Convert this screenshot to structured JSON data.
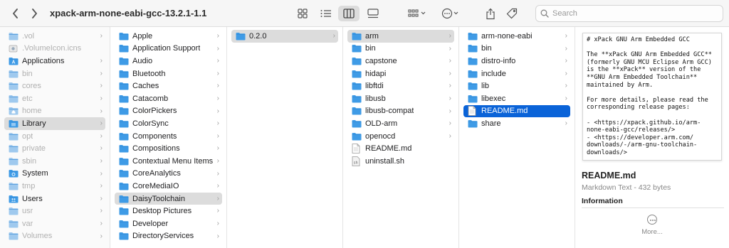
{
  "window": {
    "title": "xpack-arm-none-eabi-gcc-13.2.1-1.1"
  },
  "toolbar": {
    "search_placeholder": "Search",
    "icons": [
      "chevron-left-icon",
      "chevron-right-icon",
      "icon-view-icon",
      "list-view-icon",
      "column-view-icon",
      "gallery-view-icon",
      "group-icon",
      "more-actions-icon",
      "share-icon",
      "tag-icon",
      "search-icon"
    ]
  },
  "columns": {
    "col1": [
      {
        "label": ".vol",
        "kind": "folder",
        "dim": true,
        "chevron": true
      },
      {
        "label": ".VolumeIcon.icns",
        "kind": "file-icns",
        "dim": true,
        "chevron": false
      },
      {
        "label": "Applications",
        "kind": "folder-app",
        "dim": false,
        "chevron": true
      },
      {
        "label": "bin",
        "kind": "folder",
        "dim": true,
        "chevron": true
      },
      {
        "label": "cores",
        "kind": "folder",
        "dim": true,
        "chevron": true
      },
      {
        "label": "etc",
        "kind": "folder",
        "dim": true,
        "chevron": true
      },
      {
        "label": "home",
        "kind": "folder-home",
        "dim": true,
        "chevron": true
      },
      {
        "label": "Library",
        "kind": "folder-lib",
        "dim": false,
        "chevron": true,
        "selected": "gray"
      },
      {
        "label": "opt",
        "kind": "folder",
        "dim": true,
        "chevron": true
      },
      {
        "label": "private",
        "kind": "folder",
        "dim": true,
        "chevron": true
      },
      {
        "label": "sbin",
        "kind": "folder",
        "dim": true,
        "chevron": true
      },
      {
        "label": "System",
        "kind": "folder-sys",
        "dim": false,
        "chevron": true
      },
      {
        "label": "tmp",
        "kind": "folder",
        "dim": true,
        "chevron": true
      },
      {
        "label": "Users",
        "kind": "folder-users",
        "dim": false,
        "chevron": true
      },
      {
        "label": "usr",
        "kind": "folder",
        "dim": true,
        "chevron": true
      },
      {
        "label": "var",
        "kind": "folder",
        "dim": true,
        "chevron": true
      },
      {
        "label": "Volumes",
        "kind": "folder",
        "dim": true,
        "chevron": true
      }
    ],
    "col2": [
      {
        "label": "Apple",
        "chevron": true
      },
      {
        "label": "Application Support",
        "chevron": true
      },
      {
        "label": "Audio",
        "chevron": true
      },
      {
        "label": "Bluetooth",
        "chevron": true
      },
      {
        "label": "Caches",
        "chevron": true
      },
      {
        "label": "Catacomb",
        "chevron": true
      },
      {
        "label": "ColorPickers",
        "chevron": true
      },
      {
        "label": "ColorSync",
        "chevron": true
      },
      {
        "label": "Components",
        "chevron": true
      },
      {
        "label": "Compositions",
        "chevron": true
      },
      {
        "label": "Contextual Menu Items",
        "chevron": true
      },
      {
        "label": "CoreAnalytics",
        "chevron": true
      },
      {
        "label": "CoreMediaIO",
        "chevron": true
      },
      {
        "label": "DaisyToolchain",
        "chevron": true,
        "selected": "gray"
      },
      {
        "label": "Desktop Pictures",
        "chevron": true
      },
      {
        "label": "Developer",
        "chevron": true
      },
      {
        "label": "DirectoryServices",
        "chevron": true
      }
    ],
    "col3": [
      {
        "label": "0.2.0",
        "chevron": true,
        "selected": "gray"
      }
    ],
    "col4": [
      {
        "label": "arm",
        "kind": "folder",
        "chevron": true,
        "selected": "gray"
      },
      {
        "label": "bin",
        "kind": "folder",
        "chevron": true
      },
      {
        "label": "capstone",
        "kind": "folder",
        "chevron": true
      },
      {
        "label": "hidapi",
        "kind": "folder",
        "chevron": true
      },
      {
        "label": "libftdi",
        "kind": "folder",
        "chevron": true
      },
      {
        "label": "libusb",
        "kind": "folder",
        "chevron": true
      },
      {
        "label": "libusb-compat",
        "kind": "folder",
        "chevron": true
      },
      {
        "label": "OLD-arm",
        "kind": "folder",
        "chevron": true
      },
      {
        "label": "openocd",
        "kind": "folder",
        "chevron": true
      },
      {
        "label": "README.md",
        "kind": "doc",
        "chevron": false
      },
      {
        "label": "uninstall.sh",
        "kind": "script",
        "chevron": false
      }
    ],
    "col5": [
      {
        "label": "arm-none-eabi",
        "kind": "folder",
        "chevron": true
      },
      {
        "label": "bin",
        "kind": "folder",
        "chevron": true
      },
      {
        "label": "distro-info",
        "kind": "folder",
        "chevron": true
      },
      {
        "label": "include",
        "kind": "folder",
        "chevron": true
      },
      {
        "label": "lib",
        "kind": "folder",
        "chevron": true
      },
      {
        "label": "libexec",
        "kind": "folder",
        "chevron": true
      },
      {
        "label": "README.md",
        "kind": "doc",
        "chevron": false,
        "selected": "blue"
      },
      {
        "label": "share",
        "kind": "folder",
        "chevron": true
      }
    ]
  },
  "preview": {
    "document_text": "# xPack GNU Arm Embedded GCC\n\nThe **xPack GNU Arm Embedded GCC**\n(formerly GNU MCU Eclipse Arm GCC)\nis the **xPack** version of the\n**GNU Arm Embedded Toolchain**\nmaintained by Arm.\n\nFor more details, please read the\ncorresponding release pages:\n\n- <https://xpack.github.io/arm-\nnone-eabi-gcc/releases/>\n- <https://developer.arm.com/\ndownloads/-/arm-gnu-toolchain-\ndownloads/>",
    "file_name": "README.md",
    "file_kind": "Markdown Text - 432 bytes",
    "info_heading": "Information",
    "more_label": "More..."
  },
  "colors": {
    "folder_blue": "#3f9be6",
    "selection_blue": "#0a63d8",
    "selection_gray": "#dcdcdc"
  }
}
